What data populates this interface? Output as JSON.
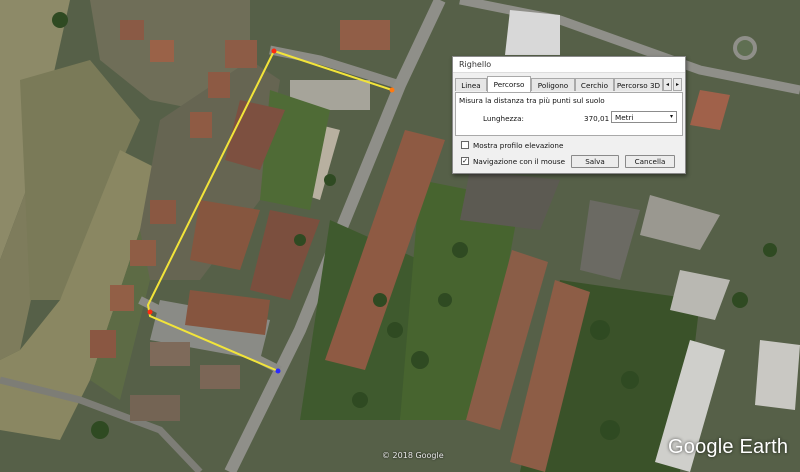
{
  "dialog": {
    "title": "Righello",
    "tabs": [
      {
        "label": "Linea",
        "active": false
      },
      {
        "label": "Percorso",
        "active": true
      },
      {
        "label": "Poligono",
        "active": false
      },
      {
        "label": "Cerchio",
        "active": false
      },
      {
        "label": "Percorso 3D",
        "active": false
      }
    ],
    "tab_scroll_left": "◂",
    "tab_scroll_right": "▸",
    "description": "Misura la distanza tra più punti sul suolo",
    "length_label": "Lunghezza:",
    "length_value": "370,01",
    "unit_selected": "Metri",
    "elevation_checkbox": {
      "label": "Mostra profilo elevazione",
      "checked": false
    },
    "mouse_nav_checkbox": {
      "label": "Navigazione con il mouse",
      "checked": true,
      "mark": "✓"
    },
    "save_label": "Salva",
    "cancel_label": "Cancella",
    "dropdown_icon": "▾"
  },
  "map": {
    "copyright": "© 2018 Google",
    "brand": "Google Earth",
    "path_color": "#f2e43a",
    "point_color": "#ff2a10"
  }
}
